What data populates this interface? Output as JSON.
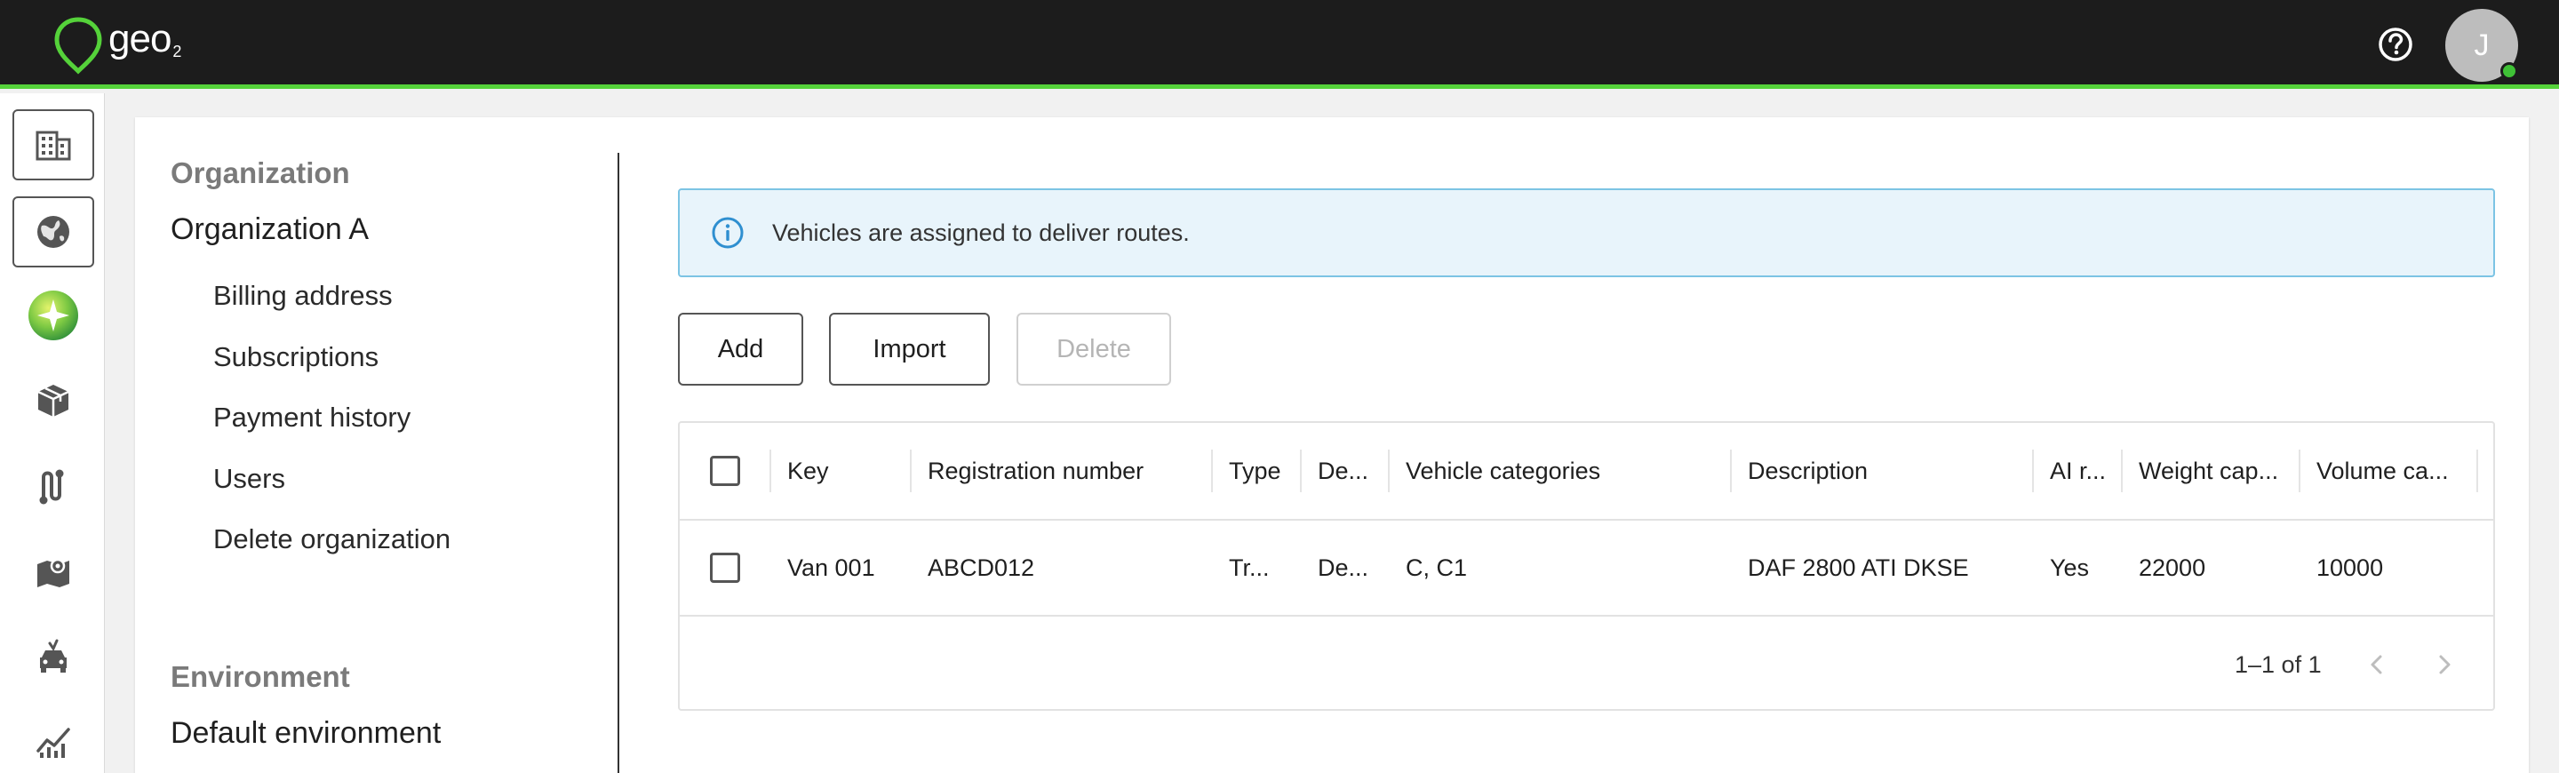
{
  "app": {
    "logo_text": "geo",
    "logo_sub": "2",
    "avatar_initial": "J",
    "accent": "#55d23a",
    "online_color": "#3fc136"
  },
  "rail": {
    "items": [
      {
        "icon": "building-icon",
        "boxed": true
      },
      {
        "icon": "globe-icon",
        "boxed": true
      },
      {
        "icon": "sparkle-orb-icon",
        "boxed": false
      },
      {
        "icon": "package-icon",
        "boxed": false
      },
      {
        "icon": "route-icon",
        "boxed": false
      },
      {
        "icon": "map-icon",
        "boxed": false
      },
      {
        "icon": "vehicle-icon",
        "boxed": false
      },
      {
        "icon": "analytics-icon",
        "boxed": false
      }
    ]
  },
  "org_nav": {
    "organization_heading": "Organization",
    "organization_name": "Organization A",
    "items": [
      "Billing address",
      "Subscriptions",
      "Payment history",
      "Users",
      "Delete organization"
    ],
    "environment_heading": "Environment",
    "environment_name": "Default environment"
  },
  "banner": {
    "text": "Vehicles are assigned to deliver routes.",
    "color": "#e8f4fb"
  },
  "toolbar": {
    "add_label": "Add",
    "import_label": "Import",
    "delete_label": "Delete"
  },
  "table": {
    "columns": [
      "Key",
      "Registration number",
      "Type",
      "De...",
      "Vehicle categories",
      "Description",
      "AI r...",
      "Weight cap...",
      "Volume ca..."
    ],
    "rows": [
      [
        "Van 001",
        "ABCD012",
        "Tr...",
        "De...",
        "C, C1",
        "DAF 2800 ATI DKSE",
        "Yes",
        "22000",
        "10000"
      ]
    ],
    "pagination": "1–1 of 1"
  }
}
